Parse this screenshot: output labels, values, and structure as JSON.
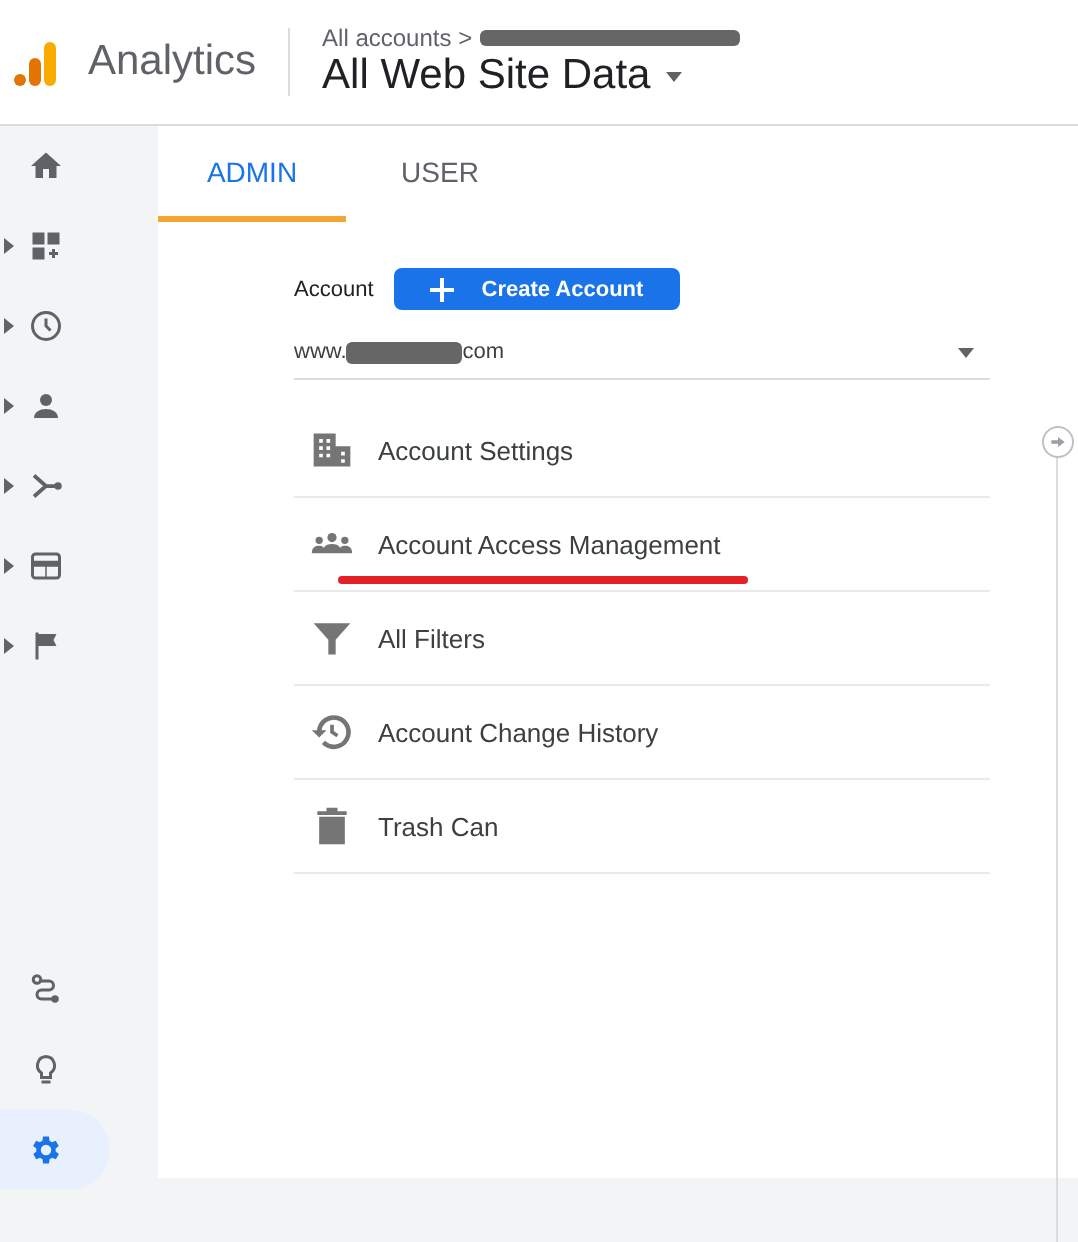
{
  "header": {
    "product": "Analytics",
    "breadcrumb": "All accounts >",
    "view": "All Web Site Data"
  },
  "nav": {
    "items": [
      {
        "kind": "link",
        "selected": false
      },
      {
        "kind": "group",
        "selected": false
      },
      {
        "kind": "group",
        "selected": false
      },
      {
        "kind": "group",
        "selected": false
      },
      {
        "kind": "group",
        "selected": false
      },
      {
        "kind": "group",
        "selected": false
      },
      {
        "kind": "group",
        "selected": false
      }
    ],
    "bottom": [
      {
        "selected": false
      },
      {
        "selected": false
      },
      {
        "selected": true
      }
    ]
  },
  "tabs": [
    {
      "label": "ADMIN",
      "selected": true
    },
    {
      "label": "USER",
      "selected": false
    }
  ],
  "account": {
    "label": "Account",
    "button": "Create Account",
    "prefix": "www.",
    "suffix": "com"
  },
  "menu": [
    {
      "label": "Account Settings",
      "underlined": false
    },
    {
      "label": "Account Access Management",
      "underlined": true
    },
    {
      "label": "All Filters",
      "underlined": false
    },
    {
      "label": "Account Change History",
      "underlined": false
    },
    {
      "label": "Trash Can",
      "underlined": false
    }
  ]
}
